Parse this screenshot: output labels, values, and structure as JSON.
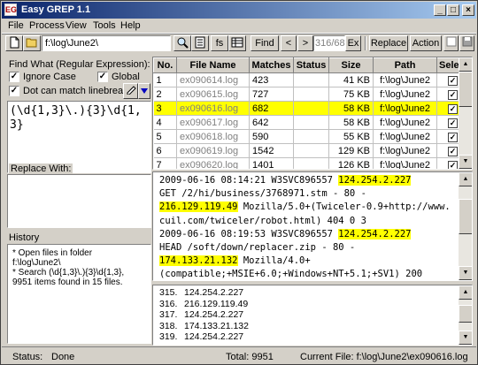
{
  "window": {
    "title": "Easy GREP 1.1",
    "app_icon": "EG",
    "min": "_",
    "max": "□",
    "close": "×"
  },
  "menu": [
    "File",
    "Process",
    "View",
    "Tools",
    "Help"
  ],
  "toolbar": {
    "path_value": "f:\\log\\June2\\",
    "fs_label": "fs",
    "find_label": "Find",
    "prev_label": "<",
    "next_label": ">",
    "match_counter": "316/682",
    "ex_label": "Ex",
    "replace_label": "Replace",
    "action_label": "Action"
  },
  "find_panel": {
    "heading": "Find What (Regular Expression):",
    "ignore_case": {
      "label": "Ignore Case",
      "checked": true
    },
    "global": {
      "label": "Global",
      "checked": true
    },
    "dot_linebreaks": {
      "label": "Dot can match linebreaks",
      "checked": true
    },
    "regex_value": "(\\d{1,3}\\.){3}\\d{1,3}"
  },
  "replace_panel": {
    "heading": "Replace With:",
    "value": ""
  },
  "history_panel": {
    "heading": "History",
    "entries": [
      "* Open files in folder\nf:\\log\\June2\\",
      "* Search (\\d{1,3}\\.){3}\\d{1,3},\n9951 items found in 15 files."
    ]
  },
  "file_table": {
    "columns": [
      "No.",
      "File Name",
      "Matches",
      "Status",
      "Size",
      "Path",
      "Select"
    ],
    "rows": [
      {
        "no": "1",
        "name": "ex090614.log",
        "matches": "423",
        "status": "",
        "size": "41 KB",
        "path": "f:\\log\\June2",
        "selected": false
      },
      {
        "no": "2",
        "name": "ex090615.log",
        "matches": "727",
        "status": "",
        "size": "75 KB",
        "path": "f:\\log\\June2",
        "selected": false
      },
      {
        "no": "3",
        "name": "ex090616.log",
        "matches": "682",
        "status": "",
        "size": "58 KB",
        "path": "f:\\log\\June2",
        "selected": true
      },
      {
        "no": "4",
        "name": "ex090617.log",
        "matches": "642",
        "status": "",
        "size": "58 KB",
        "path": "f:\\log\\June2",
        "selected": false
      },
      {
        "no": "5",
        "name": "ex090618.log",
        "matches": "590",
        "status": "",
        "size": "55 KB",
        "path": "f:\\log\\June2",
        "selected": false
      },
      {
        "no": "6",
        "name": "ex090619.log",
        "matches": "1542",
        "status": "",
        "size": "129 KB",
        "path": "f:\\log\\June2",
        "selected": false
      },
      {
        "no": "7",
        "name": "ex090620.log",
        "matches": "1401",
        "status": "",
        "size": "126 KB",
        "path": "f:\\log\\June2",
        "selected": false
      }
    ]
  },
  "preview": {
    "segments": [
      {
        "t": "2009-06-16 08:14:21 W3SVC896557 ",
        "h": false
      },
      {
        "t": "124.254.2.227",
        "h": true
      },
      {
        "t": "\nGET /2/hi/business/3768971.stm - 80 -\n",
        "h": false
      },
      {
        "t": "216.129.119.49",
        "h": true
      },
      {
        "t": " Mozilla/5.0+(Twiceler-0.9+http://www.cuil.com/twiceler/robot.html) 404 0 3\n2009-06-16 08:19:53 W3SVC896557 ",
        "h": false
      },
      {
        "t": "124.254.2.227",
        "h": true
      },
      {
        "t": "\nHEAD /soft/down/replacer.zip - 80 -\n",
        "h": false
      },
      {
        "t": "174.133.21.132",
        "h": true
      },
      {
        "t": " Mozilla/4.0+\n(compatible;+MSIE+6.0;+Windows+NT+5.1;+SV1) 200",
        "h": false
      }
    ]
  },
  "match_lines": [
    {
      "no": "315.",
      "ip": "124.254.2.227"
    },
    {
      "no": "316.",
      "ip": "216.129.119.49"
    },
    {
      "no": "317.",
      "ip": "124.254.2.227"
    },
    {
      "no": "318.",
      "ip": "174.133.21.132"
    },
    {
      "no": "319.",
      "ip": "124.254.2.227"
    }
  ],
  "status": {
    "status_label": "Status:",
    "status_value": "Done",
    "total": "Total: 9951",
    "current_file": "Current File: f:\\log\\June2\\ex090616.log"
  }
}
